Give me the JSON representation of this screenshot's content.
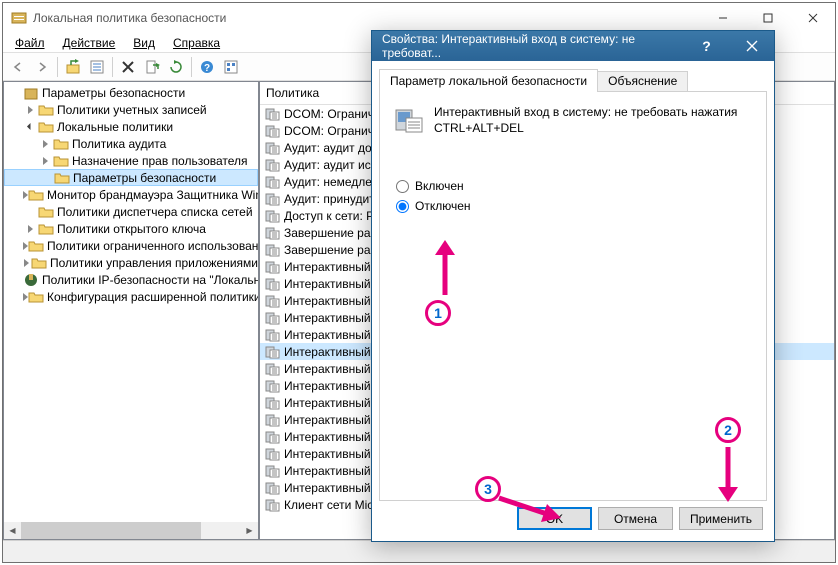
{
  "window": {
    "title": "Локальная политика безопасности"
  },
  "menu": {
    "file": "Файл",
    "action": "Действие",
    "view": "Вид",
    "help": "Справка"
  },
  "tree": {
    "root": "Параметры безопасности",
    "items": [
      "Политики учетных записей",
      "Локальные политики",
      "Монитор брандмауэра Защитника Windows",
      "Политики диспетчера списка сетей",
      "Политики открытого ключа",
      "Политики ограниченного использования",
      "Политики управления приложениями",
      "Политики IP-безопасности на \"Локальный",
      "Конфигурация расширенной политики"
    ],
    "local_children": [
      "Политика аудита",
      "Назначение прав пользователя",
      "Параметры безопасности"
    ]
  },
  "list": {
    "header": "Политика",
    "rows": [
      "DCOM: Ограничения",
      "DCOM: Ограничения",
      "Аудит: аудит доступа",
      "Аудит: аудит использования",
      "Аудит: немедленное",
      "Аудит: принудительно",
      "Доступ к сети: Разрешить",
      "Завершение работы",
      "Завершение работы",
      "Интерактивный вход",
      "Интерактивный вход",
      "Интерактивный вход",
      "Интерактивный вход",
      "Интерактивный вход",
      "Интерактивный вход",
      "Интерактивный вход",
      "Интерактивный вход",
      "Интерактивный вход",
      "Интерактивный вход",
      "Интерактивный вход",
      "Интерактивный вход",
      "Интерактивный вход",
      "Интерактивный вход",
      "Клиент сети Microsoft"
    ],
    "selected_index": 14
  },
  "dialog": {
    "title": "Свойства: Интерактивный вход в систему: не требоват...",
    "tab_active": "Параметр локальной безопасности",
    "tab_inactive": "Объяснение",
    "policy_text": "Интерактивный вход в систему: не требовать нажатия CTRL+ALT+DEL",
    "radio_on": "Включен",
    "radio_off": "Отключен",
    "btn_ok": "OK",
    "btn_cancel": "Отмена",
    "btn_apply": "Применить"
  },
  "annotations": {
    "one": "1",
    "two": "2",
    "three": "3"
  }
}
